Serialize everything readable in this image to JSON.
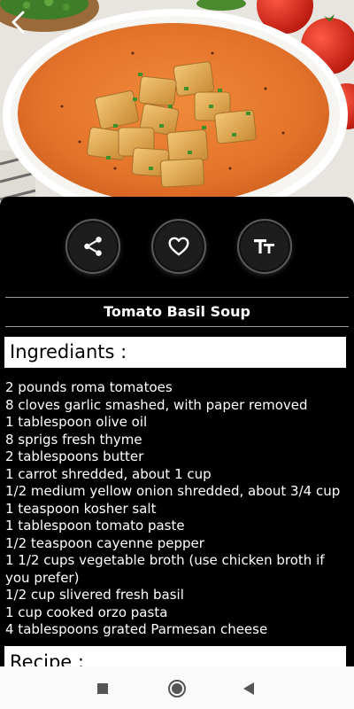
{
  "app": {
    "icons": {
      "back": "chevron-left-icon",
      "share": "share-icon",
      "favorite": "heart-icon",
      "text_size": "text-size-icon"
    }
  },
  "recipe": {
    "title": "Tomato Basil Soup",
    "ingredients_header": "Ingrediants :",
    "ingredients": [
      "2 pounds roma tomatoes",
      "8 cloves garlic smashed, with paper removed",
      "1 tablespoon olive oil",
      "8 sprigs fresh thyme",
      "2 tablespoons butter",
      "1 carrot shredded, about 1 cup",
      "1/2 medium yellow onion shredded, about 3/4 cup",
      "1 teaspoon kosher salt",
      "1 tablespoon tomato paste",
      "1/2 teaspoon cayenne pepper",
      "1 1/2 cups vegetable broth (use chicken broth if you prefer)",
      "1/2 cup slivered fresh basil",
      "1 cup cooked orzo pasta",
      "4 tablespoons grated Parmesan cheese"
    ],
    "recipe_header": "Recipe :"
  },
  "system_nav": {
    "icons": [
      "recent-apps-icon",
      "home-icon",
      "back-triangle-icon"
    ]
  },
  "colors": {
    "background": "#000000",
    "text": "#ffffff",
    "soup": "#e8782f",
    "nav_bar": "#fafafa"
  }
}
